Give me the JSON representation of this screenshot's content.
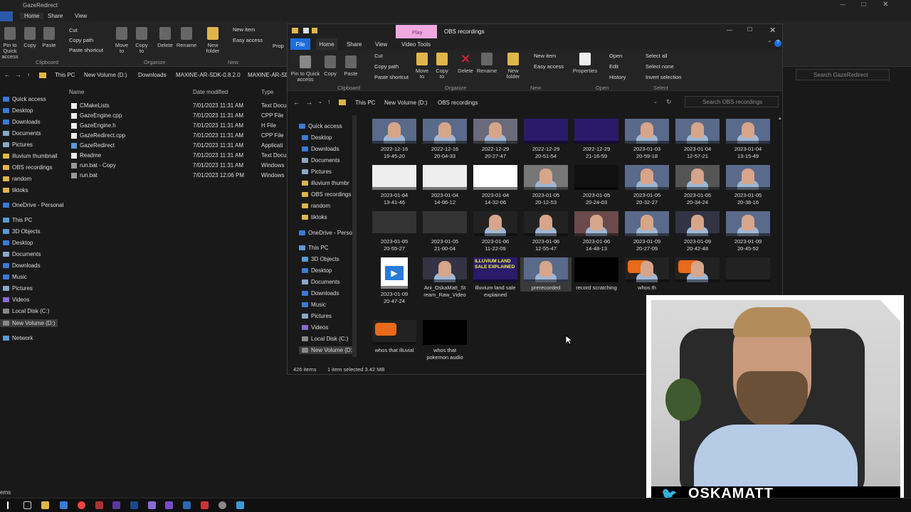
{
  "bg_window": {
    "title": "GazeRedirect",
    "tabs": [
      "File",
      "Home",
      "Share",
      "View"
    ],
    "ribbon": {
      "buttons": [
        "Pin to Quick access",
        "Copy",
        "Paste",
        "Move to",
        "Copy to",
        "Delete",
        "Rename",
        "New folder"
      ],
      "small": [
        "Cut",
        "Copy path",
        "Paste shortcut",
        "New item",
        "Easy access"
      ],
      "groups": [
        "Clipboard",
        "Organize",
        "New"
      ],
      "prop": "Prop"
    },
    "path": [
      "This PC",
      "New Volume (D:)",
      "Downloads",
      "MAXINE-AR-SDK-0.8.2.0",
      "MAXINE-AR-SD"
    ],
    "search_placeholder": "Search GazeRedirect",
    "nav": [
      "Quick access",
      "Desktop",
      "Downloads",
      "Documents",
      "Pictures",
      "illuvium thumbnail",
      "OBS recordings",
      "random",
      "tiktoks",
      "OneDrive - Personal",
      "This PC",
      "3D Objects",
      "Desktop",
      "Documents",
      "Downloads",
      "Music",
      "Pictures",
      "Videos",
      "Local Disk (C:)",
      "New Volume (D:)",
      "Network"
    ],
    "columns": [
      "Name",
      "Date modified",
      "Type"
    ],
    "files": [
      {
        "name": "CMakeLists",
        "date": "7/01/2023 11:31 AM",
        "type": "Text Docu"
      },
      {
        "name": "GazeEngine.cpp",
        "date": "7/01/2023 11:31 AM",
        "type": "CPP File"
      },
      {
        "name": "GazeEngine.h",
        "date": "7/01/2023 11:31 AM",
        "type": "H File"
      },
      {
        "name": "GazeRedirect.cpp",
        "date": "7/01/2023 11:31 AM",
        "type": "CPP File"
      },
      {
        "name": "GazeRedirect",
        "date": "7/01/2023 11:31 AM",
        "type": "Applicati"
      },
      {
        "name": "Readme",
        "date": "7/01/2023 11:31 AM",
        "type": "Text Docu"
      },
      {
        "name": "run.bat - Copy",
        "date": "7/01/2023 11:31 AM",
        "type": "Windows"
      },
      {
        "name": "run.bat",
        "date": "7/01/2023 12:06 PM",
        "type": "Windows"
      }
    ],
    "status": "ems"
  },
  "fw": {
    "title": "OBS recordings",
    "play_tab": "Play",
    "tabs": [
      "File",
      "Home",
      "Share",
      "View",
      "Video Tools"
    ],
    "ribbon": {
      "buttons": [
        "Pin to Quick access",
        "Copy",
        "Paste",
        "Move to",
        "Copy to",
        "Delete",
        "Rename",
        "New folder",
        "Properties"
      ],
      "small": [
        "Cut",
        "Copy path",
        "Paste shortcut",
        "New item",
        "Easy access",
        "Open",
        "Edit",
        "History",
        "Select all",
        "Select none",
        "Invert selection"
      ],
      "groups": [
        "Clipboard",
        "Organize",
        "New",
        "Open",
        "Select"
      ]
    },
    "path": [
      "This PC",
      "New Volume (D:)",
      "OBS recordings"
    ],
    "search_placeholder": "Search OBS recordings",
    "nav": [
      "Quick access",
      "Desktop",
      "Downloads",
      "Documents",
      "Pictures",
      "illuvium thumbr",
      "OBS recordings",
      "random",
      "tiktoks",
      "OneDrive - Persor",
      "This PC",
      "3D Objects",
      "Desktop",
      "Documents",
      "Downloads",
      "Music",
      "Pictures",
      "Videos",
      "Local Disk (C:)",
      "New Volume (D:"
    ],
    "items": [
      [
        "2022-12-16",
        "19-45-20"
      ],
      [
        "2022-12-16",
        "20-04-33"
      ],
      [
        "2022-12-29",
        "20-27-47"
      ],
      [
        "2022-12-29",
        "20-51-54"
      ],
      [
        "2022-12-29",
        "21-16-59"
      ],
      [
        "2023-01-03",
        "20-59-18"
      ],
      [
        "2023-01-04",
        "12-57-21"
      ],
      [
        "2023-01-04",
        "13-15-49"
      ],
      [
        "2023-01-04",
        "13-41-46"
      ],
      [
        "2023-01-04",
        "14-06-12"
      ],
      [
        "2023-01-04",
        "14-32-06"
      ],
      [
        "2023-01-05",
        "20-12-53"
      ],
      [
        "2023-01-05",
        "20-24-03"
      ],
      [
        "2023-01-05",
        "20-32-27"
      ],
      [
        "2023-01-05",
        "20-34-24"
      ],
      [
        "2023-01-05",
        "20-38-16"
      ],
      [
        "2023-01-05",
        "20-55-27"
      ],
      [
        "2023-01-05",
        "21-00-04"
      ],
      [
        "2023-01-06",
        "11-22-09"
      ],
      [
        "2023-01-06",
        "12-55-47"
      ],
      [
        "2023-01-06",
        "14-48-13"
      ],
      [
        "2023-01-09",
        "20-27-09"
      ],
      [
        "2023-01-09",
        "20-42-48"
      ],
      [
        "2023-01-09",
        "20-45-52"
      ],
      [
        "2023-01-09",
        "20-47-24"
      ],
      [
        "Ani_OskaMatt_St",
        "ream_Raw_Video"
      ],
      [
        "illuvium land sale",
        "explained"
      ],
      [
        "prerecorded",
        ""
      ],
      [
        "record scratching",
        ""
      ],
      [
        "whos th",
        ""
      ],
      [
        "",
        ""
      ],
      [
        "",
        ""
      ],
      [
        "whos that illuvial",
        ""
      ],
      [
        "whos that",
        "pokemon audio"
      ]
    ],
    "status_count": "426 items",
    "status_selected": "1 item selected  3.42 MB",
    "thumb_text": "ILLUVIUM LAND SALE EXPLAINED"
  },
  "cam": {
    "handle": "OSKAMATT"
  }
}
